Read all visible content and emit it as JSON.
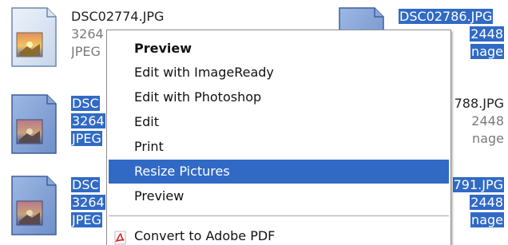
{
  "files": [
    {
      "name": "DSC02774.JPG",
      "dims": "3264",
      "type": "JPEG",
      "selected": false
    },
    {
      "name": "DSC",
      "dims": "3264",
      "type": "JPEG",
      "selected": true
    },
    {
      "name": "DSC",
      "dims": "3264",
      "type": "JPEG",
      "selected": true
    },
    {
      "name": "DSC02786.JPG",
      "dims": "2448",
      "type": "nage",
      "selected": true
    },
    {
      "name": "788.JPG",
      "dims": "2448",
      "type": "nage",
      "selected": false
    },
    {
      "name": "791.JPG",
      "dims": "2448",
      "type": "nage",
      "selected": true
    }
  ],
  "context_menu": {
    "items": [
      {
        "label": "Preview",
        "bold": true
      },
      {
        "label": "Edit with ImageReady"
      },
      {
        "label": "Edit with Photoshop"
      },
      {
        "label": "Edit"
      },
      {
        "label": "Print"
      },
      {
        "label": "Resize Pictures",
        "highlighted": true
      },
      {
        "label": "Preview"
      },
      {
        "label": "Convert to Adobe PDF",
        "icon": "adobe-pdf-icon"
      }
    ]
  },
  "colors": {
    "selection": "#316ac5",
    "pdf_red": "#d4201a"
  }
}
